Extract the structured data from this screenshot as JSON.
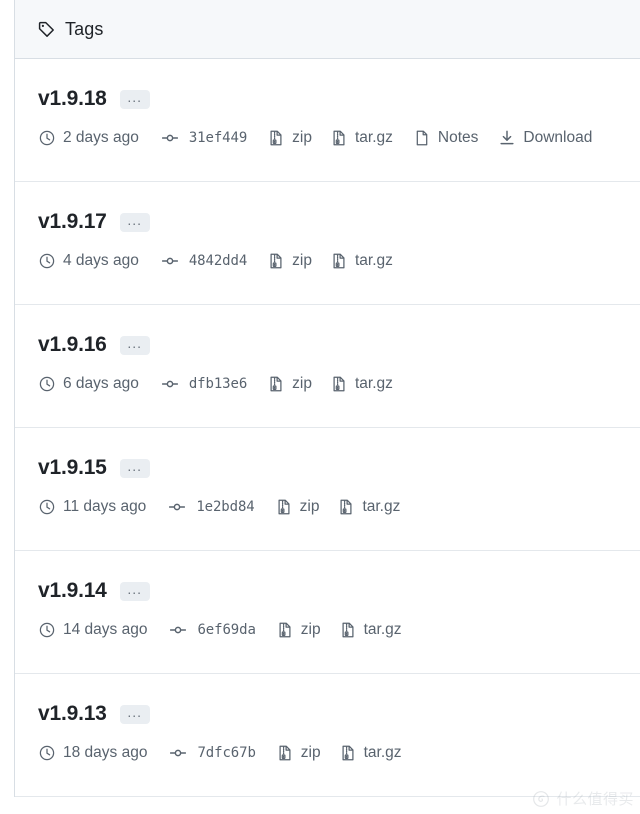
{
  "header": {
    "title": "Tags",
    "icon": "tag-icon",
    "background": "#f6f8fa"
  },
  "colors": {
    "text_primary": "#1f2328",
    "text_muted": "#59636e",
    "border": "#d8dee4",
    "row_border": "#e4e8ec",
    "badge_bg": "#eaeef2"
  },
  "labels": {
    "zip": "zip",
    "targz": "tar.gz",
    "notes": "Notes",
    "download": "Download",
    "ellipsis": "..."
  },
  "tags": [
    {
      "name": "v1.9.18",
      "ellipsis": "...",
      "age": "2 days ago",
      "commit": "31ef449",
      "zip": "zip",
      "targz": "tar.gz",
      "notes": "Notes",
      "download": "Download",
      "has_notes": true,
      "has_download": true
    },
    {
      "name": "v1.9.17",
      "ellipsis": "...",
      "age": "4 days ago",
      "commit": "4842dd4",
      "zip": "zip",
      "targz": "tar.gz",
      "has_notes": false,
      "has_download": false
    },
    {
      "name": "v1.9.16",
      "ellipsis": "...",
      "age": "6 days ago",
      "commit": "dfb13e6",
      "zip": "zip",
      "targz": "tar.gz",
      "has_notes": false,
      "has_download": false
    },
    {
      "name": "v1.9.15",
      "ellipsis": "...",
      "age": "11 days ago",
      "commit": "1e2bd84",
      "zip": "zip",
      "targz": "tar.gz",
      "has_notes": false,
      "has_download": false
    },
    {
      "name": "v1.9.14",
      "ellipsis": "...",
      "age": "14 days ago",
      "commit": "6ef69da",
      "zip": "zip",
      "targz": "tar.gz",
      "has_notes": false,
      "has_download": false
    },
    {
      "name": "v1.9.13",
      "ellipsis": "...",
      "age": "18 days ago",
      "commit": "7dfc67b",
      "zip": "zip",
      "targz": "tar.gz",
      "has_notes": false,
      "has_download": false
    }
  ],
  "watermark": {
    "text": "什么值得买"
  }
}
